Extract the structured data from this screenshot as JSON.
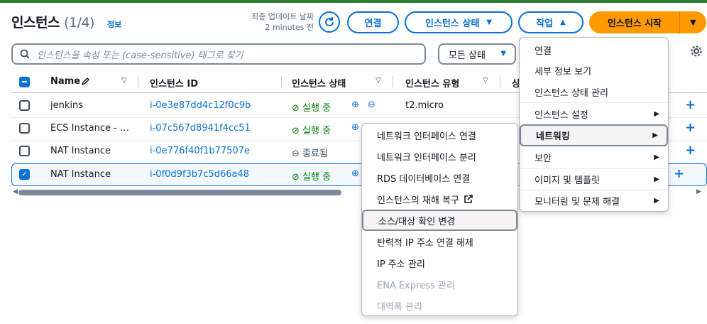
{
  "header": {
    "title": "인스턴스",
    "count": "(1/4)",
    "info_link": "정보",
    "last_update_label": "최종 업데이트 날짜",
    "last_update_value": "2 minutes 전",
    "connect_button": "연결",
    "instance_state_button": "인스턴스 상태",
    "actions_button": "작업",
    "launch_button": "인스턴스 시작"
  },
  "search": {
    "placeholder": "인스턴스을 속성 또는 (case-sensitive) 태그로 찾기"
  },
  "filter": {
    "selected": "모든 상태"
  },
  "table": {
    "columns": [
      "Name",
      "인스턴스 ID",
      "인스턴스 상태",
      "인스턴스 유형",
      "상"
    ],
    "rows": [
      {
        "name": "jenkins",
        "id": "i-0e3e87dd4c12f0c9b",
        "state": "실행 중",
        "type": "t2.micro",
        "selected": false
      },
      {
        "name": "ECS Instance - …",
        "id": "i-07c567d8941f4cc51",
        "state": "실행 중",
        "type": "",
        "selected": false
      },
      {
        "name": "NAT Instance",
        "id": "i-0e776f40f1b77507e",
        "state": "종료됨",
        "type": "",
        "selected": false
      },
      {
        "name": "NAT Instance",
        "id": "i-0f0d9f3b7c5d66a48",
        "state": "실행 중",
        "type": "",
        "selected": true
      }
    ]
  },
  "actions_menu": {
    "items": [
      {
        "label": "연결",
        "submenu": false
      },
      {
        "label": "세부 정보 보기",
        "submenu": false
      },
      {
        "label": "인스턴스 상태 관리",
        "submenu": false
      },
      {
        "label": "인스턴스 설정",
        "submenu": true
      },
      {
        "label": "네트워킹",
        "submenu": true
      },
      {
        "label": "보안",
        "submenu": true
      },
      {
        "label": "이미지 및 템플릿",
        "submenu": true
      },
      {
        "label": "모니터링 및 문제 해결",
        "submenu": true
      }
    ]
  },
  "networking_menu": {
    "items": [
      {
        "label": "네트워크 인터페이스 연결",
        "disabled": false
      },
      {
        "label": "네트워크 인터페이스 분리",
        "disabled": false
      },
      {
        "label": "RDS 데이터베이스 연결",
        "disabled": false
      },
      {
        "label": "인스턴스의 재해 복구",
        "disabled": false
      },
      {
        "label": "소스/대상 확인 변경",
        "disabled": false
      },
      {
        "label": "탄력적 IP 주소 연결 해제",
        "disabled": false
      },
      {
        "label": "IP 주소 관리",
        "disabled": false
      },
      {
        "label": "ENA Express 관리",
        "disabled": true
      },
      {
        "label": "대역폭 관리",
        "disabled": true
      }
    ]
  },
  "colors": {
    "accent": "#0972d3",
    "primary": "#ff9900",
    "running": "#037f0c"
  }
}
